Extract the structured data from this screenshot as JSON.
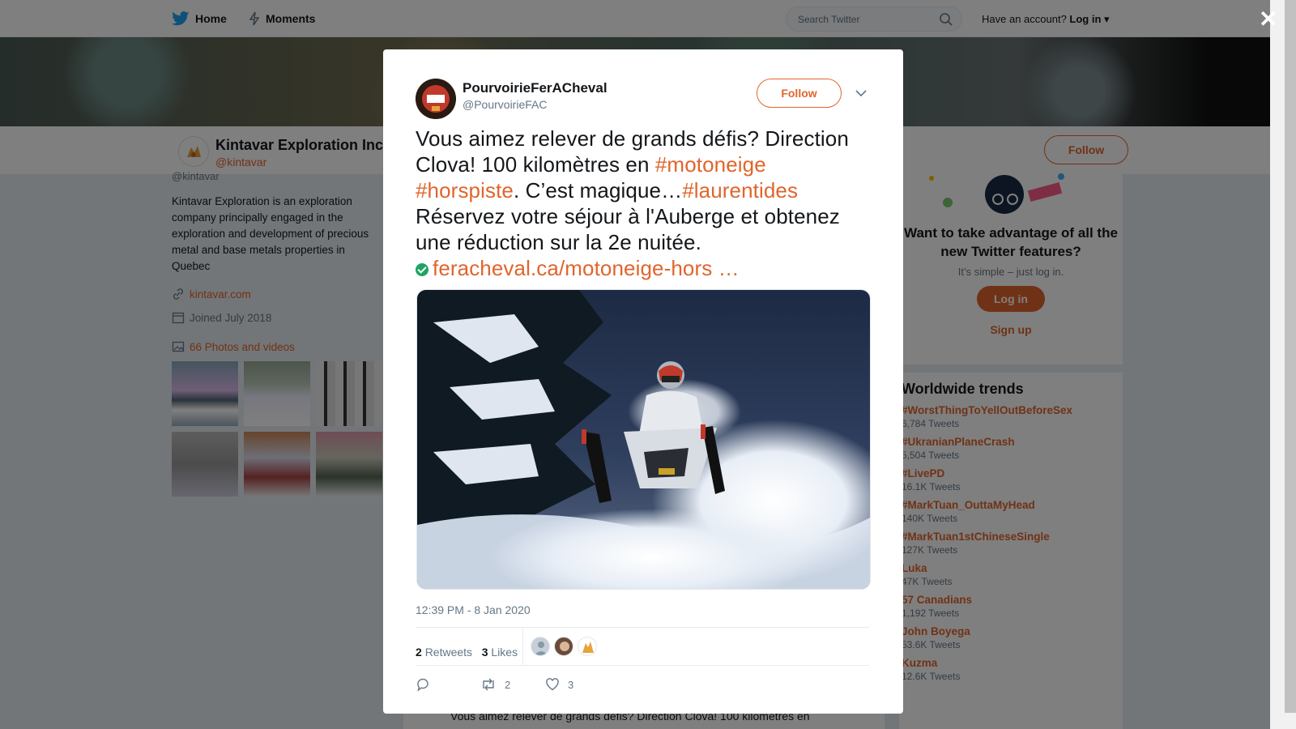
{
  "nav": {
    "home_label": "Home",
    "moments_label": "Moments",
    "search_placeholder": "Search Twitter",
    "account_prompt": "Have an account?",
    "login_label": "Log in"
  },
  "profile": {
    "name": "Kintavar Exploration Inc.",
    "handle": "@kintavar",
    "follow_label": "Follow",
    "bio": "Kintavar Exploration is an exploration company principally engaged in the exploration and development of precious metal and base metals properties in Quebec",
    "website": "kintavar.com",
    "joined": "Joined July 2018",
    "photos_label": "66 Photos and videos"
  },
  "login_prompt": {
    "title": "Want to take advantage of all the new Twitter features?",
    "subtitle": "It’s simple – just log in.",
    "login_label": "Log in",
    "signup_label": "Sign up"
  },
  "trends": {
    "title": "Worldwide trends",
    "items": [
      {
        "name": "#WorstThingToYellOutBeforeSex",
        "count": "6,784 Tweets"
      },
      {
        "name": "#UkranianPlaneCrash",
        "count": "5,504 Tweets"
      },
      {
        "name": "#LivePD",
        "count": "16.1K Tweets"
      },
      {
        "name": "#MarkTuan_OuttaMyHead",
        "count": "140K Tweets"
      },
      {
        "name": "#MarkTuan1stChineseSingle",
        "count": "127K Tweets"
      },
      {
        "name": "Luka",
        "count": "47K Tweets"
      },
      {
        "name": "57 Canadians",
        "count": "1,192 Tweets"
      },
      {
        "name": "John Boyega",
        "count": "53.6K Tweets"
      },
      {
        "name": "Kuzma",
        "count": "12.6K Tweets"
      }
    ]
  },
  "background_tweet": {
    "text": "Vous aimez relever de grands défis? Direction Clova! 100 kilomètres en"
  },
  "modal": {
    "author_name": "PourvoirieFerACheval",
    "author_handle": "@PourvoirieFAC",
    "follow_label": "Follow",
    "text_1": "Vous aimez relever de grands défis? Direction Clova! 100 kilomètres en ",
    "tag_1": "#motoneige",
    "tag_2": "#horspiste",
    "text_2": ". C’est magique…",
    "tag_3": "#laurentides",
    "text_3": " Réservez votre séjour à l'Auberge et obtenez une réduction sur la 2e nuitée.",
    "link": "feracheval.ca/motoneige-hors …",
    "timestamp": "12:39 PM - 8 Jan 2020",
    "retweets_count": "2",
    "retweets_label": "Retweets",
    "likes_count": "3",
    "likes_label": "Likes",
    "action_retweet_count": "2",
    "action_like_count": "3"
  },
  "colors": {
    "accent": "#e0652c",
    "twitter_blue": "#1da1f2",
    "muted": "#657786"
  }
}
